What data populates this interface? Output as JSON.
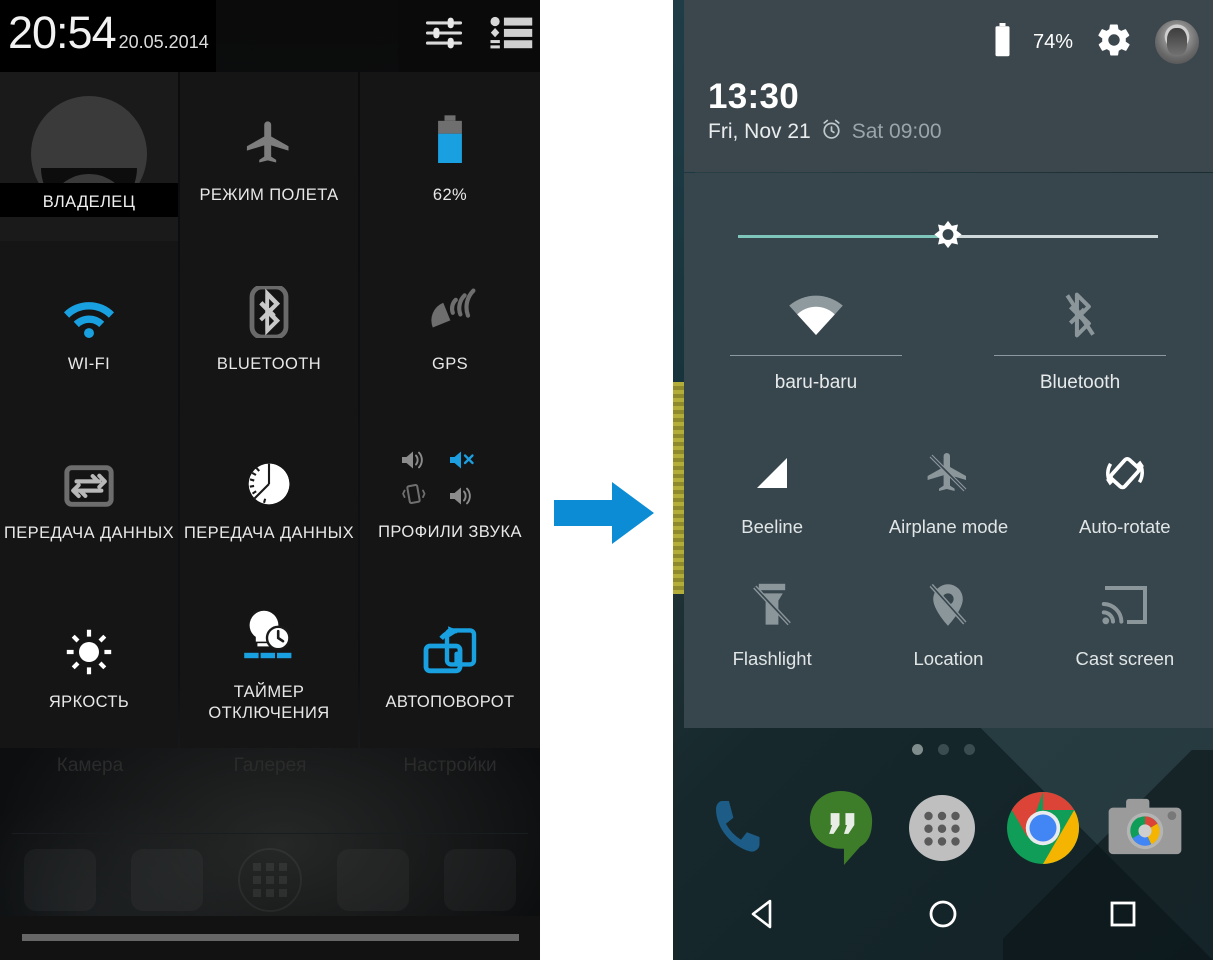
{
  "left_panel": {
    "status_bar": {
      "time": "20:54",
      "date": "20.05.2014",
      "icons": [
        {
          "name": "sliders-icon",
          "label": "Quick settings toggles"
        },
        {
          "name": "list-icon",
          "label": "Notifications list"
        }
      ]
    },
    "tiles": [
      {
        "icon": "owner-avatar-icon",
        "label": "ВЛАДЕЛЕЦ",
        "state": "owner",
        "active": false
      },
      {
        "icon": "airplane-icon",
        "label": "РЕЖИМ ПОЛЕТА",
        "active": false
      },
      {
        "icon": "battery-icon",
        "label": "62%",
        "active": true
      },
      {
        "icon": "wifi-icon",
        "label": "WI-FI",
        "active": true
      },
      {
        "icon": "bluetooth-icon",
        "label": "BLUETOOTH",
        "active": false
      },
      {
        "icon": "gps-satellite-icon",
        "label": "GPS",
        "active": false
      },
      {
        "icon": "data-transfer-icon",
        "label": "ПЕРЕДАЧА ДАННЫХ",
        "active": false
      },
      {
        "icon": "data-usage-pie-icon",
        "label": "ПЕРЕДАЧА ДАННЫХ",
        "active": false
      },
      {
        "icon": "sound-profiles-icon",
        "label": "ПРОФИЛИ ЗВУКА",
        "active": false
      },
      {
        "icon": "brightness-sun-icon",
        "label": "ЯРКОСТЬ",
        "active": false
      },
      {
        "icon": "sleep-timer-icon",
        "label": "ТАЙМЕР ОТКЛЮЧЕНИЯ",
        "active": false
      },
      {
        "icon": "auto-rotate-icon",
        "label": "АВТОПОВОРОТ",
        "active": true
      }
    ],
    "sound_profile_icons": [
      "speaker-icon",
      "speaker-mute-icon",
      "vibrate-icon",
      "speaker-loud-icon"
    ],
    "background_apps": [
      "Камера",
      "Галерея",
      "Настройки"
    ]
  },
  "middle": {
    "arrow": {
      "name": "right-arrow-icon",
      "color": "#0b8cd4"
    }
  },
  "right_panel": {
    "status": {
      "battery_percent": "74%",
      "battery_icon": "battery-full-icon",
      "settings_icon": "gear-icon",
      "avatar_icon": "user-avatar-icon"
    },
    "clock": {
      "time": "13:30",
      "date": "Fri, Nov 21",
      "alarm_icon": "alarm-clock-icon",
      "alarm": "Sat 09:00"
    },
    "brightness": {
      "label": "brightness-slider",
      "value_percent": 50,
      "fill_color": "#7ec6bc"
    },
    "wide_tiles": [
      {
        "icon": "wifi-icon",
        "label": "baru-baru",
        "active": true
      },
      {
        "icon": "bluetooth-off-icon",
        "label": "Bluetooth",
        "active": false
      }
    ],
    "tiles": [
      {
        "icon": "signal-bars-icon",
        "label": "Beeline",
        "active": true
      },
      {
        "icon": "airplane-off-icon",
        "label": "Airplane mode",
        "active": false
      },
      {
        "icon": "auto-rotate-icon",
        "label": "Auto-rotate",
        "active": true
      },
      {
        "icon": "flashlight-off-icon",
        "label": "Flashlight",
        "active": false
      },
      {
        "icon": "location-off-icon",
        "label": "Location",
        "active": false
      },
      {
        "icon": "cast-screen-icon",
        "label": "Cast screen",
        "active": false
      }
    ],
    "page_dots": {
      "count": 3,
      "active_index": 0
    },
    "dock_icons": [
      "phone-icon",
      "hangouts-icon",
      "app-drawer-icon",
      "chrome-icon",
      "camera-icon"
    ],
    "nav_buttons": [
      {
        "icon": "back-triangle-icon",
        "label": "Back"
      },
      {
        "icon": "home-circle-icon",
        "label": "Home"
      },
      {
        "icon": "recents-square-icon",
        "label": "Recents"
      }
    ]
  }
}
